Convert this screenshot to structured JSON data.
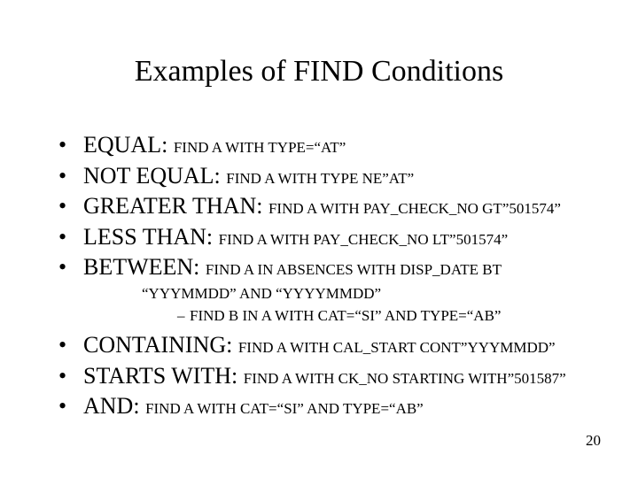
{
  "title": "Examples of FIND Conditions",
  "items": [
    {
      "lead": "EQUAL: ",
      "code": "FIND A WITH TYPE=“AT”"
    },
    {
      "lead": "NOT EQUAL: ",
      "code": "FIND A WITH TYPE NE”AT”"
    },
    {
      "lead": "GREATER THAN: ",
      "code": "FIND A WITH PAY_CHECK_NO GT”501574”"
    },
    {
      "lead": "LESS THAN: ",
      "code": "FIND A WITH PAY_CHECK_NO LT”501574”"
    },
    {
      "lead": "BETWEEN: ",
      "code": "FIND A IN ABSENCES WITH DISP_DATE BT"
    }
  ],
  "between_continuation": "“YYYMMDD” AND “YYYYMMDD”",
  "between_subitem": "FIND B IN A WITH CAT=“SI” AND TYPE=“AB”",
  "items2": [
    {
      "lead": "CONTAINING: ",
      "code": "FIND A WITH CAL_START CONT”YYYMMDD”"
    },
    {
      "lead": "STARTS WITH: ",
      "code": "FIND A WITH CK_NO STARTING WITH”501587”"
    },
    {
      "lead": "AND: ",
      "code": "FIND A WITH CAT=“SI” AND TYPE=“AB”"
    }
  ],
  "page_number": "20"
}
